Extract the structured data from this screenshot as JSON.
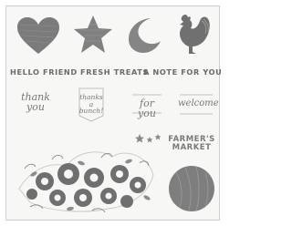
{
  "stamps": {
    "sentiments": {
      "hello_friend": "HELLO FRIEND",
      "fresh_treats": "FRESH TREATS",
      "a_note_for_you": "A NOTE FOR YOU"
    },
    "tags": {
      "thank_you": "thank you",
      "thanks_a_bunch": "thanks a bunch!",
      "for_you": "for you",
      "welcome": "welcome"
    },
    "farmers_market": {
      "line1": "FARMER'S",
      "line2": "MARKET"
    }
  },
  "icons": [
    "heart-icon",
    "star-icon",
    "moon-icon",
    "rooster-icon",
    "stars-cluster-icon",
    "floral-bouquet-icon",
    "wood-circle-icon"
  ],
  "colors": {
    "background": "#ffffff",
    "ink": "#7a7a7a",
    "ink_light": "#b9b9b9"
  }
}
